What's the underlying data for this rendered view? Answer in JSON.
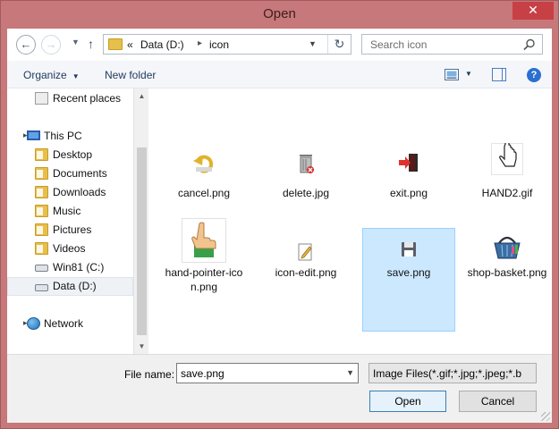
{
  "window": {
    "title": "Open",
    "close_symbol": "✕"
  },
  "nav": {
    "back_symbol": "←",
    "forward_symbol": "→",
    "up_symbol": "↑",
    "recent_symbol": "▼",
    "address": {
      "overflow": "«",
      "segments": [
        "Data (D:)",
        "icon"
      ],
      "separator": "▸",
      "dropdown_symbol": "▼",
      "refresh_symbol": "↻"
    },
    "search": {
      "placeholder": "Search icon"
    }
  },
  "toolbar": {
    "organize": "Organize",
    "new_folder": "New folder",
    "dropdown_symbol": "▼",
    "help_symbol": "?"
  },
  "sidebar": {
    "items": [
      {
        "label": "Recent places",
        "icon": "recent-places-icon"
      },
      {
        "label": "This PC",
        "icon": "this-pc-icon"
      },
      {
        "label": "Desktop",
        "icon": "folder-icon"
      },
      {
        "label": "Documents",
        "icon": "folder-icon"
      },
      {
        "label": "Downloads",
        "icon": "folder-icon"
      },
      {
        "label": "Music",
        "icon": "folder-icon"
      },
      {
        "label": "Pictures",
        "icon": "folder-icon"
      },
      {
        "label": "Videos",
        "icon": "folder-icon"
      },
      {
        "label": "Win81 (C:)",
        "icon": "drive-icon"
      },
      {
        "label": "Data (D:)",
        "icon": "drive-icon"
      },
      {
        "label": "Network",
        "icon": "network-icon"
      }
    ],
    "expander_symbol": "▸",
    "selected": "Data (D:)"
  },
  "scrollbar": {
    "up_symbol": "▲",
    "down_symbol": "▼"
  },
  "files": [
    {
      "name": "cancel.png",
      "icon": "undo-arrow-icon"
    },
    {
      "name": "delete.jpg",
      "icon": "trash-can-icon"
    },
    {
      "name": "exit.png",
      "icon": "exit-door-icon"
    },
    {
      "name": "HAND2.gif",
      "icon": "hand-cursor-icon"
    },
    {
      "name": "hand-pointer-icon.png",
      "name_line1": "hand-pointer-ico",
      "name_line2": "n.png",
      "icon": "hand-pointer-icon"
    },
    {
      "name": "icon-edit.png",
      "icon": "edit-pencil-icon"
    },
    {
      "name": "save.png",
      "icon": "floppy-disk-icon"
    },
    {
      "name": "shop-basket.png",
      "icon": "shopping-basket-icon"
    }
  ],
  "selected_file": "save.png",
  "footer": {
    "file_name_label": "File name:",
    "file_name_value": "save.png",
    "file_type": "Image Files(*.gif;*.jpg;*.jpeg;*.b",
    "open_label": "Open",
    "cancel_label": "Cancel",
    "dropdown_symbol": "▼"
  }
}
